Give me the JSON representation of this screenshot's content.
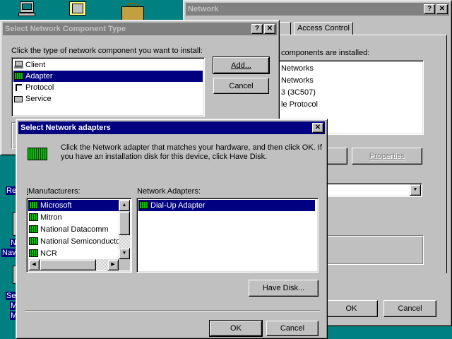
{
  "colors": {
    "desktop": "#008080",
    "title_active": "#000080",
    "title_inactive": "#808080",
    "face": "#c0c0c0"
  },
  "desktop": {
    "icons": [
      "computer-icon",
      "briefcase-icon",
      "network-server-icon"
    ],
    "partial_labels": [
      "Re",
      "N",
      "Nav",
      "Se",
      "M",
      "M"
    ]
  },
  "network_window": {
    "title": "Network",
    "tabs": [
      "ion",
      "Access Control"
    ],
    "installed_label": "components are installed:",
    "installed_items": [
      "Networks",
      "Networks",
      "3 (3C507)",
      "le Protocol"
    ],
    "properties_button": "Properties",
    "ok_button": "OK",
    "cancel_button": "Cancel"
  },
  "select_type_dialog": {
    "title": "Select Network Component Type",
    "prompt": "Click the type of network component you want to install:",
    "items": [
      {
        "label": "Client",
        "icon": "client-icon"
      },
      {
        "label": "Adapter",
        "icon": "adapter-icon",
        "selected": true
      },
      {
        "label": "Protocol",
        "icon": "protocol-icon"
      },
      {
        "label": "Service",
        "icon": "service-icon"
      }
    ],
    "add_button": "Add...",
    "cancel_button": "Cancel"
  },
  "adapters_dialog": {
    "title": "Select Network adapters",
    "instructions": "Click the Network adapter that matches your hardware, and then click OK. If you have an installation disk for this device, click Have Disk.",
    "manufacturers_label": "Manufacturers:",
    "manufacturers": [
      {
        "label": "Microsoft",
        "selected": true
      },
      {
        "label": "Mitron"
      },
      {
        "label": "National Datacomm"
      },
      {
        "label": "National Semiconductor"
      },
      {
        "label": "NCR"
      }
    ],
    "adapters_label": "Network Adapters:",
    "adapters": [
      {
        "label": "Dial-Up Adapter",
        "selected": true
      }
    ],
    "have_disk_button": "Have Disk...",
    "ok_button": "OK",
    "cancel_button": "Cancel"
  }
}
